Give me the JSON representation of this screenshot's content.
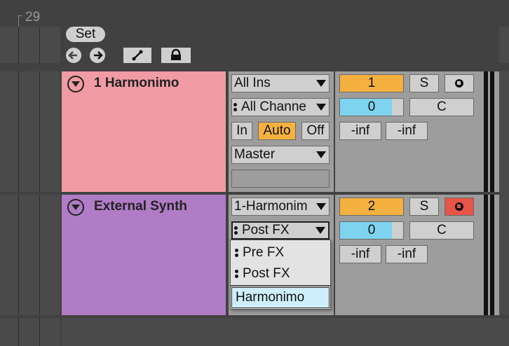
{
  "colors": {
    "bg": "#414141",
    "arrangement_bg": "#4a4a4a",
    "panel": "#9d9d9d",
    "track1": "#f19ba5",
    "track2": "#b07cc6",
    "orange": "#f5b13f",
    "blue": "#7ed4ee",
    "red": "#e75448",
    "menu_highlight": "#cfeefb"
  },
  "ruler": {
    "bar_number": "29"
  },
  "set_button": {
    "label": "Set"
  },
  "nav": {
    "back_icon": "arrow-left-icon",
    "forward_icon": "arrow-right-icon",
    "link_icon": "link-icon",
    "lock_icon": "lock-icon"
  },
  "tracks": [
    {
      "name": "1 Harmonimo",
      "input_type": "All Ins",
      "input_channel": "All Channe",
      "monitor": [
        "In",
        "Auto",
        "Off"
      ],
      "monitor_active": "Auto",
      "output": "Master",
      "track_number": "1",
      "solo": "S",
      "volume": "0",
      "pan": "C",
      "meter_left": "-inf",
      "meter_right": "-inf"
    },
    {
      "name": "External Synth",
      "input_type": "1-Harmonim",
      "input_channel": "Post FX",
      "track_number": "2",
      "solo": "S",
      "volume": "0",
      "pan": "C",
      "meter_left": "-inf",
      "meter_right": "-inf"
    }
  ],
  "dropdown_menu": {
    "items": [
      "Pre FX",
      "Post FX"
    ],
    "highlighted": "Harmonimo"
  }
}
